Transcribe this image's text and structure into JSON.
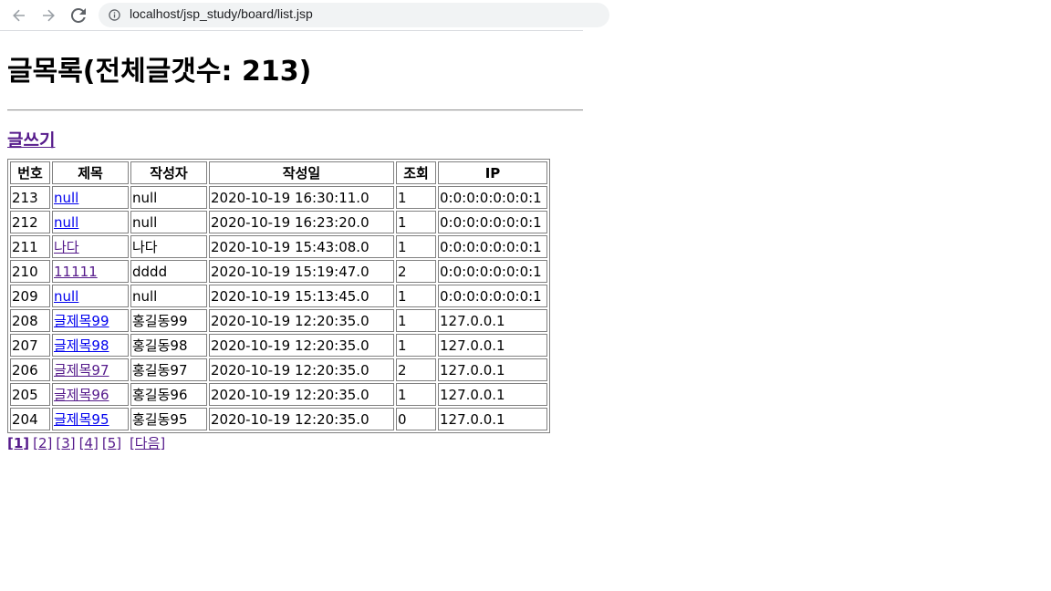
{
  "browser": {
    "url": "localhost/jsp_study/board/list.jsp"
  },
  "page": {
    "title": "글목록(전체글갯수: 213)",
    "write_link": "글쓰기"
  },
  "table": {
    "headers": [
      "번호",
      "제목",
      "작성자",
      "작성일",
      "조회",
      "IP"
    ],
    "rows": [
      {
        "no": "213",
        "title": "null",
        "writer": "null",
        "date": "2020-10-19 16:30:11.0",
        "hit": "1",
        "ip": "0:0:0:0:0:0:0:1",
        "visited": false
      },
      {
        "no": "212",
        "title": "null",
        "writer": "null",
        "date": "2020-10-19 16:23:20.0",
        "hit": "1",
        "ip": "0:0:0:0:0:0:0:1",
        "visited": false
      },
      {
        "no": "211",
        "title": "나다",
        "writer": "나다",
        "date": "2020-10-19 15:43:08.0",
        "hit": "1",
        "ip": "0:0:0:0:0:0:0:1",
        "visited": true
      },
      {
        "no": "210",
        "title": "11111",
        "writer": "dddd",
        "date": "2020-10-19 15:19:47.0",
        "hit": "2",
        "ip": "0:0:0:0:0:0:0:1",
        "visited": true
      },
      {
        "no": "209",
        "title": "null",
        "writer": "null",
        "date": "2020-10-19 15:13:45.0",
        "hit": "1",
        "ip": "0:0:0:0:0:0:0:1",
        "visited": false
      },
      {
        "no": "208",
        "title": "글제목99",
        "writer": "홍길동99",
        "date": "2020-10-19 12:20:35.0",
        "hit": "1",
        "ip": "127.0.0.1",
        "visited": false
      },
      {
        "no": "207",
        "title": "글제목98",
        "writer": "홍길동98",
        "date": "2020-10-19 12:20:35.0",
        "hit": "1",
        "ip": "127.0.0.1",
        "visited": false
      },
      {
        "no": "206",
        "title": "글제목97",
        "writer": "홍길동97",
        "date": "2020-10-19 12:20:35.0",
        "hit": "2",
        "ip": "127.0.0.1",
        "visited": true
      },
      {
        "no": "205",
        "title": "글제목96",
        "writer": "홍길동96",
        "date": "2020-10-19 12:20:35.0",
        "hit": "1",
        "ip": "127.0.0.1",
        "visited": true
      },
      {
        "no": "204",
        "title": "글제목95",
        "writer": "홍길동95",
        "date": "2020-10-19 12:20:35.0",
        "hit": "0",
        "ip": "127.0.0.1",
        "visited": false
      }
    ]
  },
  "pagination": {
    "pages": [
      "[1]",
      "[2]",
      "[3]",
      "[4]",
      "[5]"
    ],
    "current": "[1]",
    "next": "[다음]"
  },
  "colors": {
    "link": "#0000ee",
    "visited_link": "#551a8b",
    "border": "#808080"
  }
}
